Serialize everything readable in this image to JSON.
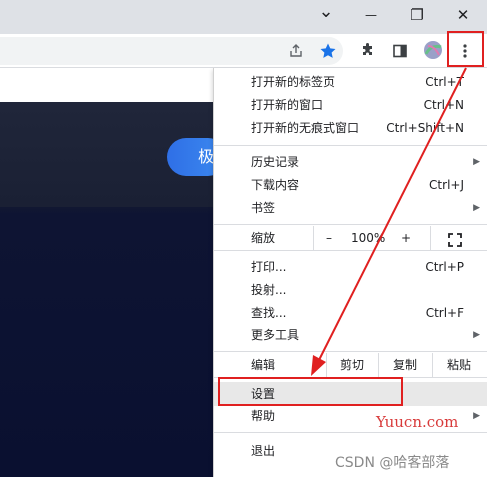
{
  "window_controls": {
    "chevron": "⌄",
    "minimize": "—",
    "restore": "❐",
    "close": "✕"
  },
  "page": {
    "button_text": "极"
  },
  "menu": {
    "new_tab": {
      "label": "打开新的标签页",
      "shortcut": "Ctrl+T"
    },
    "new_window": {
      "label": "打开新的窗口",
      "shortcut": "Ctrl+N"
    },
    "new_incognito": {
      "label": "打开新的无痕式窗口",
      "shortcut": "Ctrl+Shift+N"
    },
    "history": {
      "label": "历史记录"
    },
    "downloads": {
      "label": "下载内容",
      "shortcut": "Ctrl+J"
    },
    "bookmarks": {
      "label": "书签"
    },
    "zoom": {
      "label": "缩放",
      "minus": "–",
      "value": "100%",
      "plus": "+"
    },
    "print": {
      "label": "打印...",
      "shortcut": "Ctrl+P"
    },
    "cast": {
      "label": "投射..."
    },
    "find": {
      "label": "查找...",
      "shortcut": "Ctrl+F"
    },
    "more_tools": {
      "label": "更多工具"
    },
    "edit": {
      "label": "编辑",
      "cut": "剪切",
      "copy": "复制",
      "paste": "粘贴"
    },
    "settings": {
      "label": "设置"
    },
    "help": {
      "label": "帮助"
    },
    "exit": {
      "label": "退出"
    }
  },
  "watermarks": {
    "site": "Yuucn.com",
    "csdn": "CSDN @哈客部落"
  },
  "colors": {
    "accent_red": "#e02020",
    "star_blue": "#1a73e8",
    "page_button": "#3c8af0"
  }
}
